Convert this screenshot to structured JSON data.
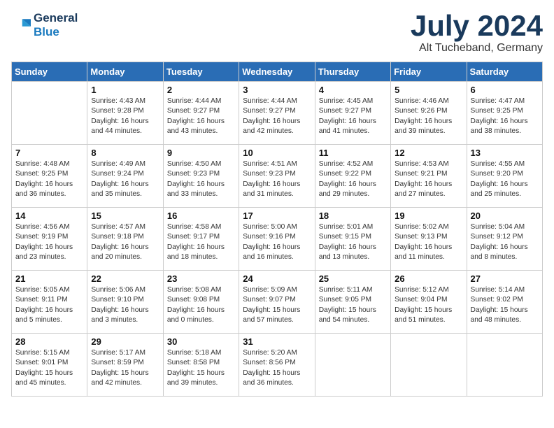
{
  "header": {
    "logo_line1": "General",
    "logo_line2": "Blue",
    "month": "July 2024",
    "location": "Alt Tucheband, Germany"
  },
  "weekdays": [
    "Sunday",
    "Monday",
    "Tuesday",
    "Wednesday",
    "Thursday",
    "Friday",
    "Saturday"
  ],
  "weeks": [
    [
      {
        "day": "",
        "info": ""
      },
      {
        "day": "1",
        "info": "Sunrise: 4:43 AM\nSunset: 9:28 PM\nDaylight: 16 hours\nand 44 minutes."
      },
      {
        "day": "2",
        "info": "Sunrise: 4:44 AM\nSunset: 9:27 PM\nDaylight: 16 hours\nand 43 minutes."
      },
      {
        "day": "3",
        "info": "Sunrise: 4:44 AM\nSunset: 9:27 PM\nDaylight: 16 hours\nand 42 minutes."
      },
      {
        "day": "4",
        "info": "Sunrise: 4:45 AM\nSunset: 9:27 PM\nDaylight: 16 hours\nand 41 minutes."
      },
      {
        "day": "5",
        "info": "Sunrise: 4:46 AM\nSunset: 9:26 PM\nDaylight: 16 hours\nand 39 minutes."
      },
      {
        "day": "6",
        "info": "Sunrise: 4:47 AM\nSunset: 9:25 PM\nDaylight: 16 hours\nand 38 minutes."
      }
    ],
    [
      {
        "day": "7",
        "info": "Sunrise: 4:48 AM\nSunset: 9:25 PM\nDaylight: 16 hours\nand 36 minutes."
      },
      {
        "day": "8",
        "info": "Sunrise: 4:49 AM\nSunset: 9:24 PM\nDaylight: 16 hours\nand 35 minutes."
      },
      {
        "day": "9",
        "info": "Sunrise: 4:50 AM\nSunset: 9:23 PM\nDaylight: 16 hours\nand 33 minutes."
      },
      {
        "day": "10",
        "info": "Sunrise: 4:51 AM\nSunset: 9:23 PM\nDaylight: 16 hours\nand 31 minutes."
      },
      {
        "day": "11",
        "info": "Sunrise: 4:52 AM\nSunset: 9:22 PM\nDaylight: 16 hours\nand 29 minutes."
      },
      {
        "day": "12",
        "info": "Sunrise: 4:53 AM\nSunset: 9:21 PM\nDaylight: 16 hours\nand 27 minutes."
      },
      {
        "day": "13",
        "info": "Sunrise: 4:55 AM\nSunset: 9:20 PM\nDaylight: 16 hours\nand 25 minutes."
      }
    ],
    [
      {
        "day": "14",
        "info": "Sunrise: 4:56 AM\nSunset: 9:19 PM\nDaylight: 16 hours\nand 23 minutes."
      },
      {
        "day": "15",
        "info": "Sunrise: 4:57 AM\nSunset: 9:18 PM\nDaylight: 16 hours\nand 20 minutes."
      },
      {
        "day": "16",
        "info": "Sunrise: 4:58 AM\nSunset: 9:17 PM\nDaylight: 16 hours\nand 18 minutes."
      },
      {
        "day": "17",
        "info": "Sunrise: 5:00 AM\nSunset: 9:16 PM\nDaylight: 16 hours\nand 16 minutes."
      },
      {
        "day": "18",
        "info": "Sunrise: 5:01 AM\nSunset: 9:15 PM\nDaylight: 16 hours\nand 13 minutes."
      },
      {
        "day": "19",
        "info": "Sunrise: 5:02 AM\nSunset: 9:13 PM\nDaylight: 16 hours\nand 11 minutes."
      },
      {
        "day": "20",
        "info": "Sunrise: 5:04 AM\nSunset: 9:12 PM\nDaylight: 16 hours\nand 8 minutes."
      }
    ],
    [
      {
        "day": "21",
        "info": "Sunrise: 5:05 AM\nSunset: 9:11 PM\nDaylight: 16 hours\nand 5 minutes."
      },
      {
        "day": "22",
        "info": "Sunrise: 5:06 AM\nSunset: 9:10 PM\nDaylight: 16 hours\nand 3 minutes."
      },
      {
        "day": "23",
        "info": "Sunrise: 5:08 AM\nSunset: 9:08 PM\nDaylight: 16 hours\nand 0 minutes."
      },
      {
        "day": "24",
        "info": "Sunrise: 5:09 AM\nSunset: 9:07 PM\nDaylight: 15 hours\nand 57 minutes."
      },
      {
        "day": "25",
        "info": "Sunrise: 5:11 AM\nSunset: 9:05 PM\nDaylight: 15 hours\nand 54 minutes."
      },
      {
        "day": "26",
        "info": "Sunrise: 5:12 AM\nSunset: 9:04 PM\nDaylight: 15 hours\nand 51 minutes."
      },
      {
        "day": "27",
        "info": "Sunrise: 5:14 AM\nSunset: 9:02 PM\nDaylight: 15 hours\nand 48 minutes."
      }
    ],
    [
      {
        "day": "28",
        "info": "Sunrise: 5:15 AM\nSunset: 9:01 PM\nDaylight: 15 hours\nand 45 minutes."
      },
      {
        "day": "29",
        "info": "Sunrise: 5:17 AM\nSunset: 8:59 PM\nDaylight: 15 hours\nand 42 minutes."
      },
      {
        "day": "30",
        "info": "Sunrise: 5:18 AM\nSunset: 8:58 PM\nDaylight: 15 hours\nand 39 minutes."
      },
      {
        "day": "31",
        "info": "Sunrise: 5:20 AM\nSunset: 8:56 PM\nDaylight: 15 hours\nand 36 minutes."
      },
      {
        "day": "",
        "info": ""
      },
      {
        "day": "",
        "info": ""
      },
      {
        "day": "",
        "info": ""
      }
    ]
  ]
}
